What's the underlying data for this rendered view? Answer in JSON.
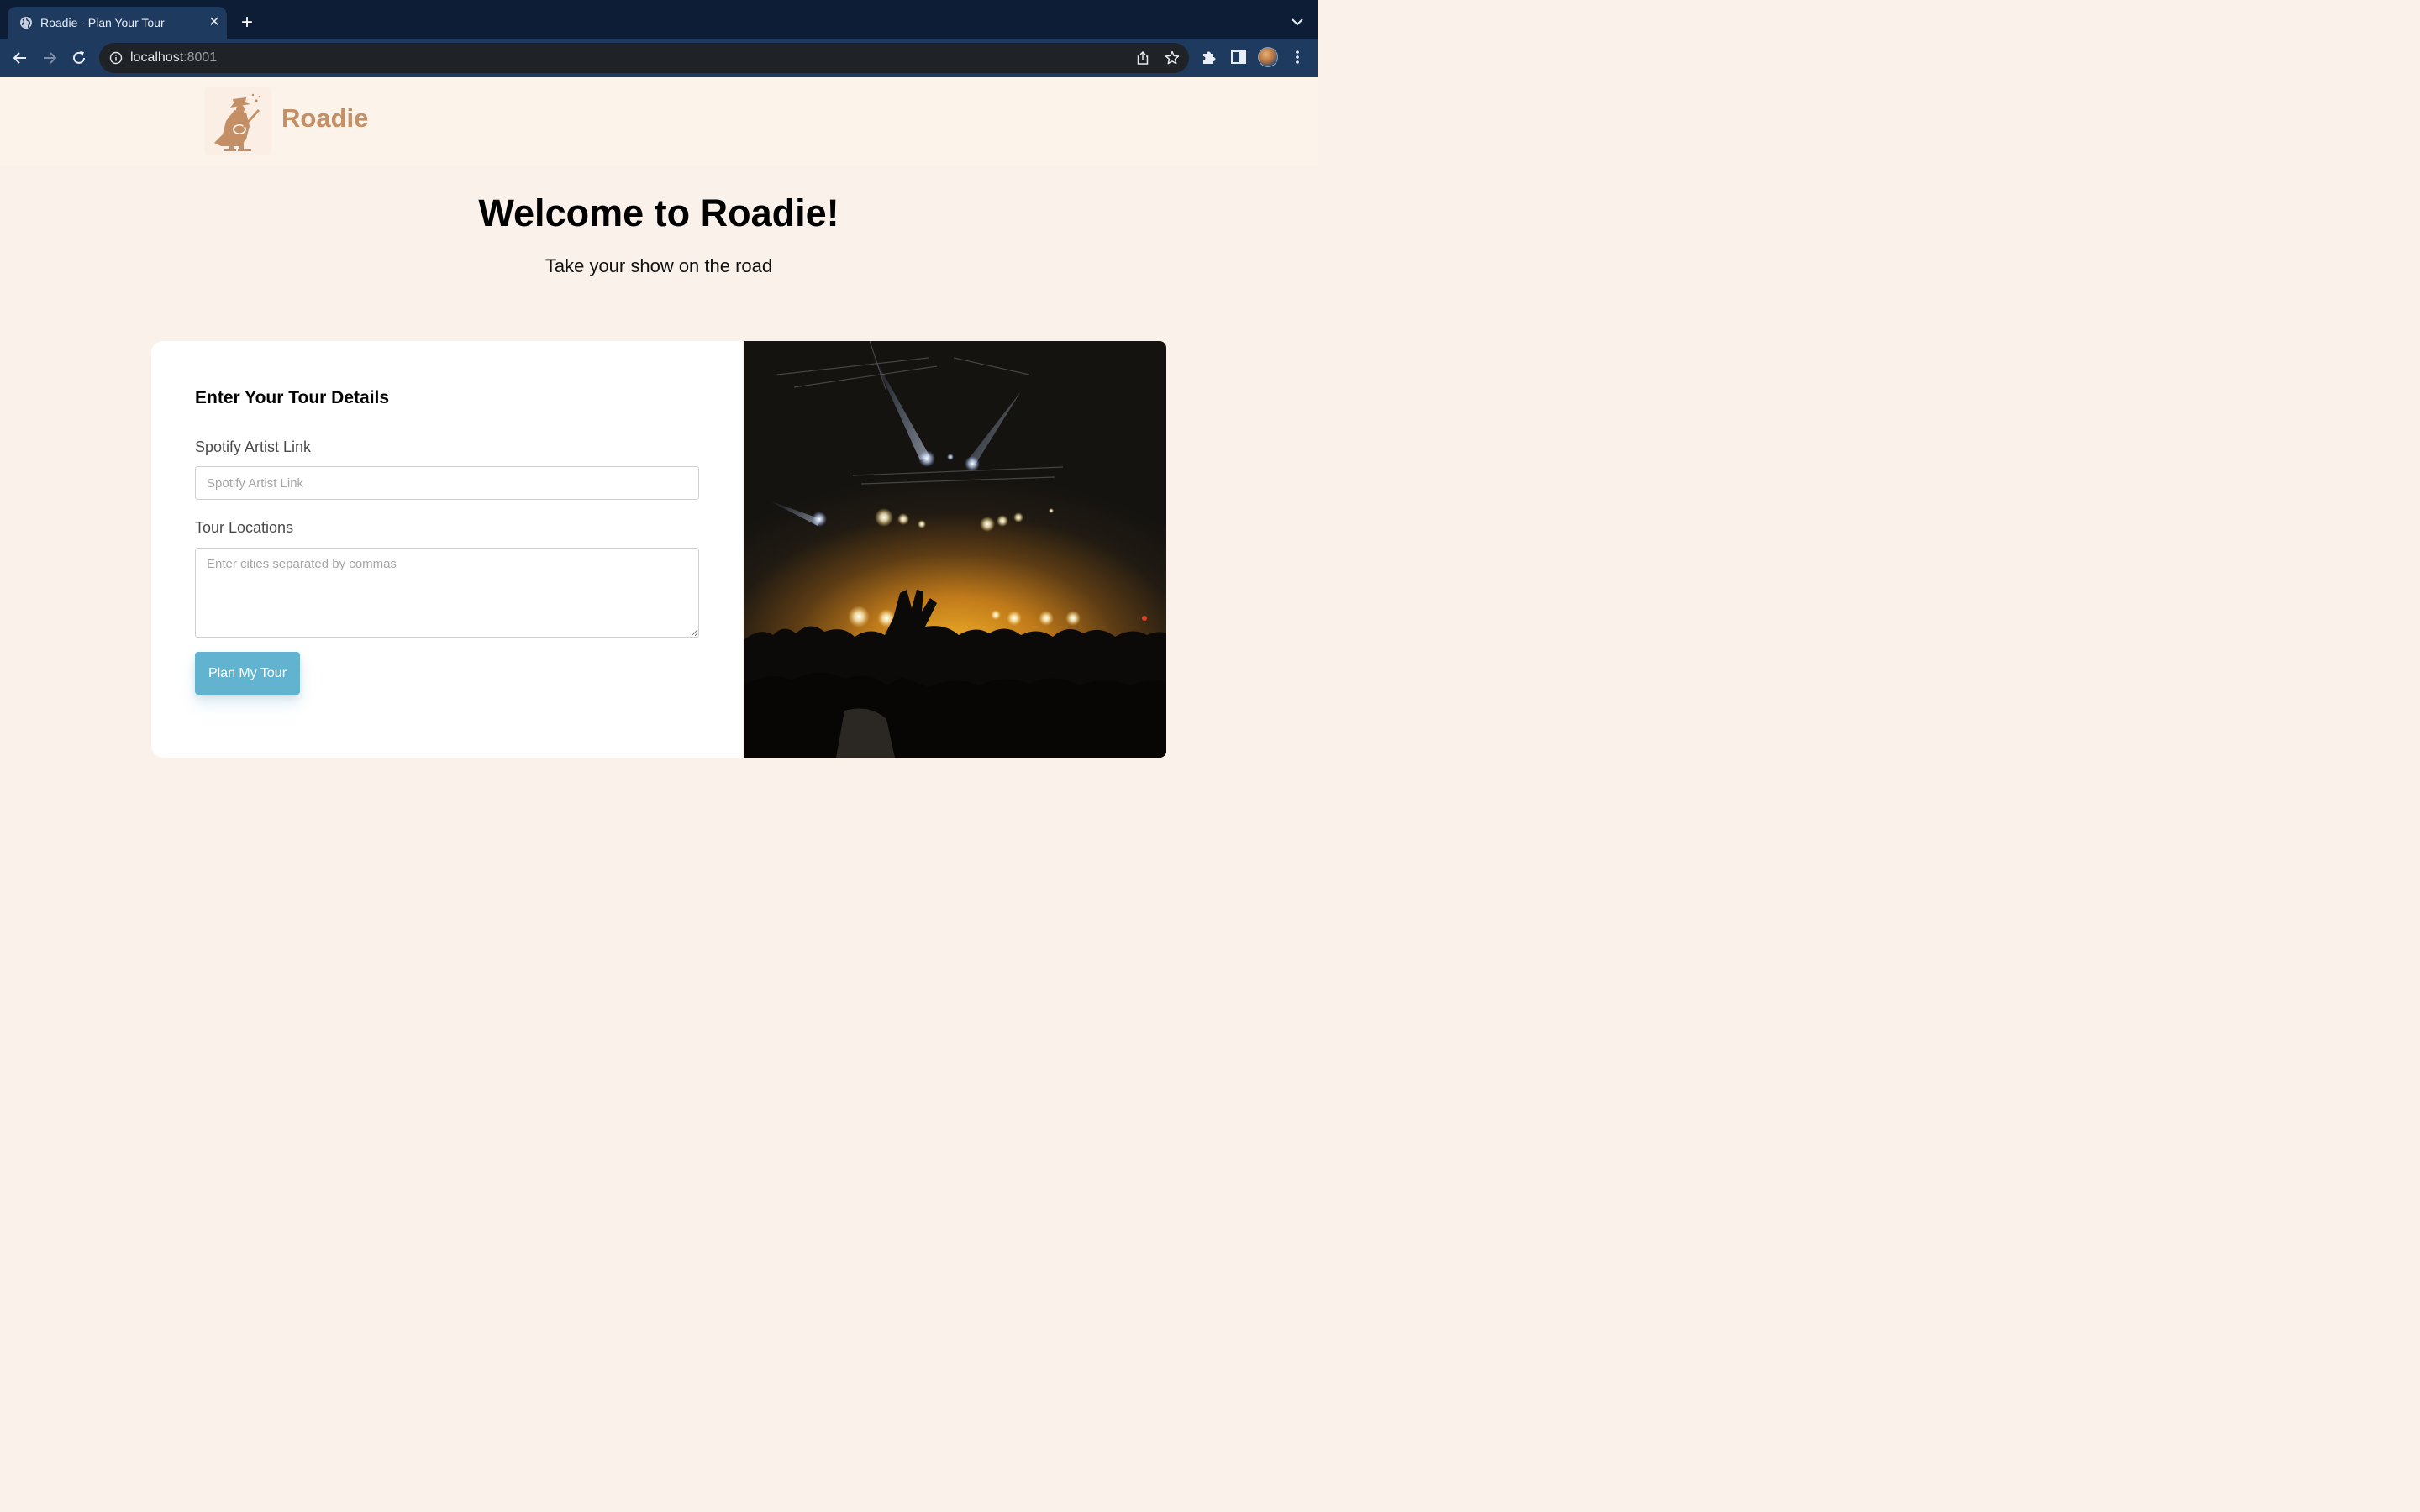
{
  "browser": {
    "tab_title": "Roadie - Plan Your Tour",
    "tab_close": "✕",
    "new_tab": "+",
    "url_host": "localhost",
    "url_port": ":8001"
  },
  "header": {
    "logo_text": "Roadie"
  },
  "hero": {
    "title": "Welcome to Roadie!",
    "subtitle": "Take your show on the road"
  },
  "form": {
    "title": "Enter Your Tour Details",
    "spotify_label": "Spotify Artist Link",
    "spotify_placeholder": "Spotify Artist Link",
    "spotify_value": "",
    "locations_label": "Tour Locations",
    "locations_placeholder": "Enter cities separated by commas",
    "locations_value": "",
    "submit_label": "Plan My Tour"
  },
  "colors": {
    "chrome_bg": "#0e1d36",
    "toolbar_bg": "#1e3a5f",
    "page_bg": "#faf1ea",
    "brand": "#c58f66",
    "button": "#62b3cf"
  },
  "icons": {
    "tab_favicon": "globe-icon",
    "back": "arrow-left-icon",
    "forward": "arrow-right-icon",
    "reload": "reload-icon",
    "site_info": "info-icon",
    "share": "share-icon",
    "bookmark": "star-icon",
    "extensions": "puzzle-icon",
    "side_panel": "side-panel-icon",
    "menu": "kebab-menu-icon",
    "logo": "guitarist-logo-icon",
    "photo": "concert-crowd-image"
  }
}
